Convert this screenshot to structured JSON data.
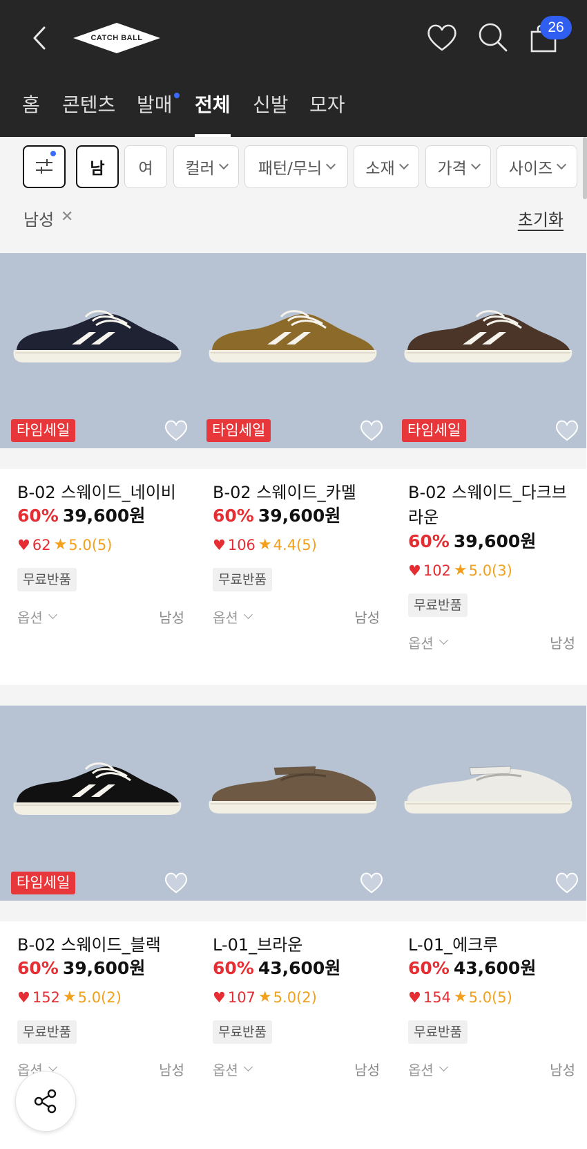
{
  "header": {
    "logo_text": "CATCH BALL",
    "cart_count": "26"
  },
  "tabs": [
    {
      "label": "홈"
    },
    {
      "label": "콘텐츠"
    },
    {
      "label": "발매"
    },
    {
      "label": "전체"
    },
    {
      "label": "신발"
    },
    {
      "label": "모자"
    }
  ],
  "filters": {
    "gender_male": "남",
    "gender_female": "여",
    "dropdowns": [
      "컬러",
      "패턴/무늬",
      "소재",
      "가격",
      "사이즈"
    ],
    "selected_tag": "남성",
    "reset_label": "초기화"
  },
  "products": [
    {
      "name": "B-02 스웨이드_네이비",
      "discount": "60%",
      "price": "39,600원",
      "likes": "62",
      "rating": "5.0(5)",
      "badge": "타임세일",
      "tag": "무료반품",
      "option": "옵션",
      "gender": "남성",
      "shoe_color": "#1f2233"
    },
    {
      "name": "B-02 스웨이드_카멜",
      "discount": "60%",
      "price": "39,600원",
      "likes": "106",
      "rating": "4.4(5)",
      "badge": "타임세일",
      "tag": "무료반품",
      "option": "옵션",
      "gender": "남성",
      "shoe_color": "#8c6a2a"
    },
    {
      "name": "B-02 스웨이드_다크브라운",
      "discount": "60%",
      "price": "39,600원",
      "likes": "102",
      "rating": "5.0(3)",
      "badge": "타임세일",
      "tag": "무료반품",
      "option": "옵션",
      "gender": "남성",
      "shoe_color": "#4a3528"
    },
    {
      "name": "B-02 스웨이드_블랙",
      "discount": "60%",
      "price": "39,600원",
      "likes": "152",
      "rating": "5.0(2)",
      "badge": "타임세일",
      "tag": "무료반품",
      "option": "옵션",
      "gender": "남성",
      "shoe_color": "#111111"
    },
    {
      "name": "L-01_브라운",
      "discount": "60%",
      "price": "43,600원",
      "likes": "107",
      "rating": "5.0(2)",
      "badge": "",
      "tag": "무료반품",
      "option": "옵션",
      "gender": "남성",
      "shoe_color": "#6e5a44"
    },
    {
      "name": "L-01_에크루",
      "discount": "60%",
      "price": "43,600원",
      "likes": "154",
      "rating": "5.0(5)",
      "badge": "",
      "tag": "무료반품",
      "option": "옵션",
      "gender": "남성",
      "shoe_color": "#ecebe6"
    }
  ],
  "colors": {
    "header_bg": "#262626",
    "accent_red": "#e52e34",
    "rating_orange": "#f2a01b",
    "badge_blue": "#2f5ef0"
  }
}
